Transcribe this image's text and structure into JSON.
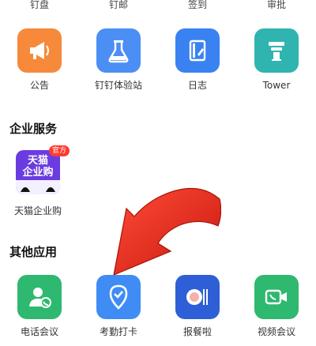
{
  "top_labels": [
    "钉盘",
    "钉邮",
    "签到",
    "审批"
  ],
  "apps_row1": [
    {
      "label": "公告",
      "icon": "megaphone-icon",
      "color": "#f7893a"
    },
    {
      "label": "钉钉体验站",
      "icon": "flask-icon",
      "color": "#4b8ff5"
    },
    {
      "label": "日志",
      "icon": "notebook-icon",
      "color": "#3a82f2"
    },
    {
      "label": "Tower",
      "icon": "tower-icon",
      "color": "#2fb4b0"
    }
  ],
  "enterprise_section": {
    "title": "企业服务",
    "app": {
      "label": "天猫企业购",
      "line1": "天猫",
      "line2": "企业购",
      "badge": "官方",
      "icon": "tmall-logo-icon"
    }
  },
  "other_section": {
    "title": "其他应用",
    "apps": [
      {
        "label": "电话会议",
        "icon": "phone-conference-icon",
        "color": "#2fb86f"
      },
      {
        "label": "考勤打卡",
        "icon": "location-check-icon",
        "color": "#3f8cf5"
      },
      {
        "label": "报餐啦",
        "icon": "meal-report-icon",
        "color": "#2e5fd6"
      },
      {
        "label": "视频会议",
        "icon": "video-call-icon",
        "color": "#2fb86f"
      }
    ]
  },
  "accent_arrow_color": "#e82a1e"
}
